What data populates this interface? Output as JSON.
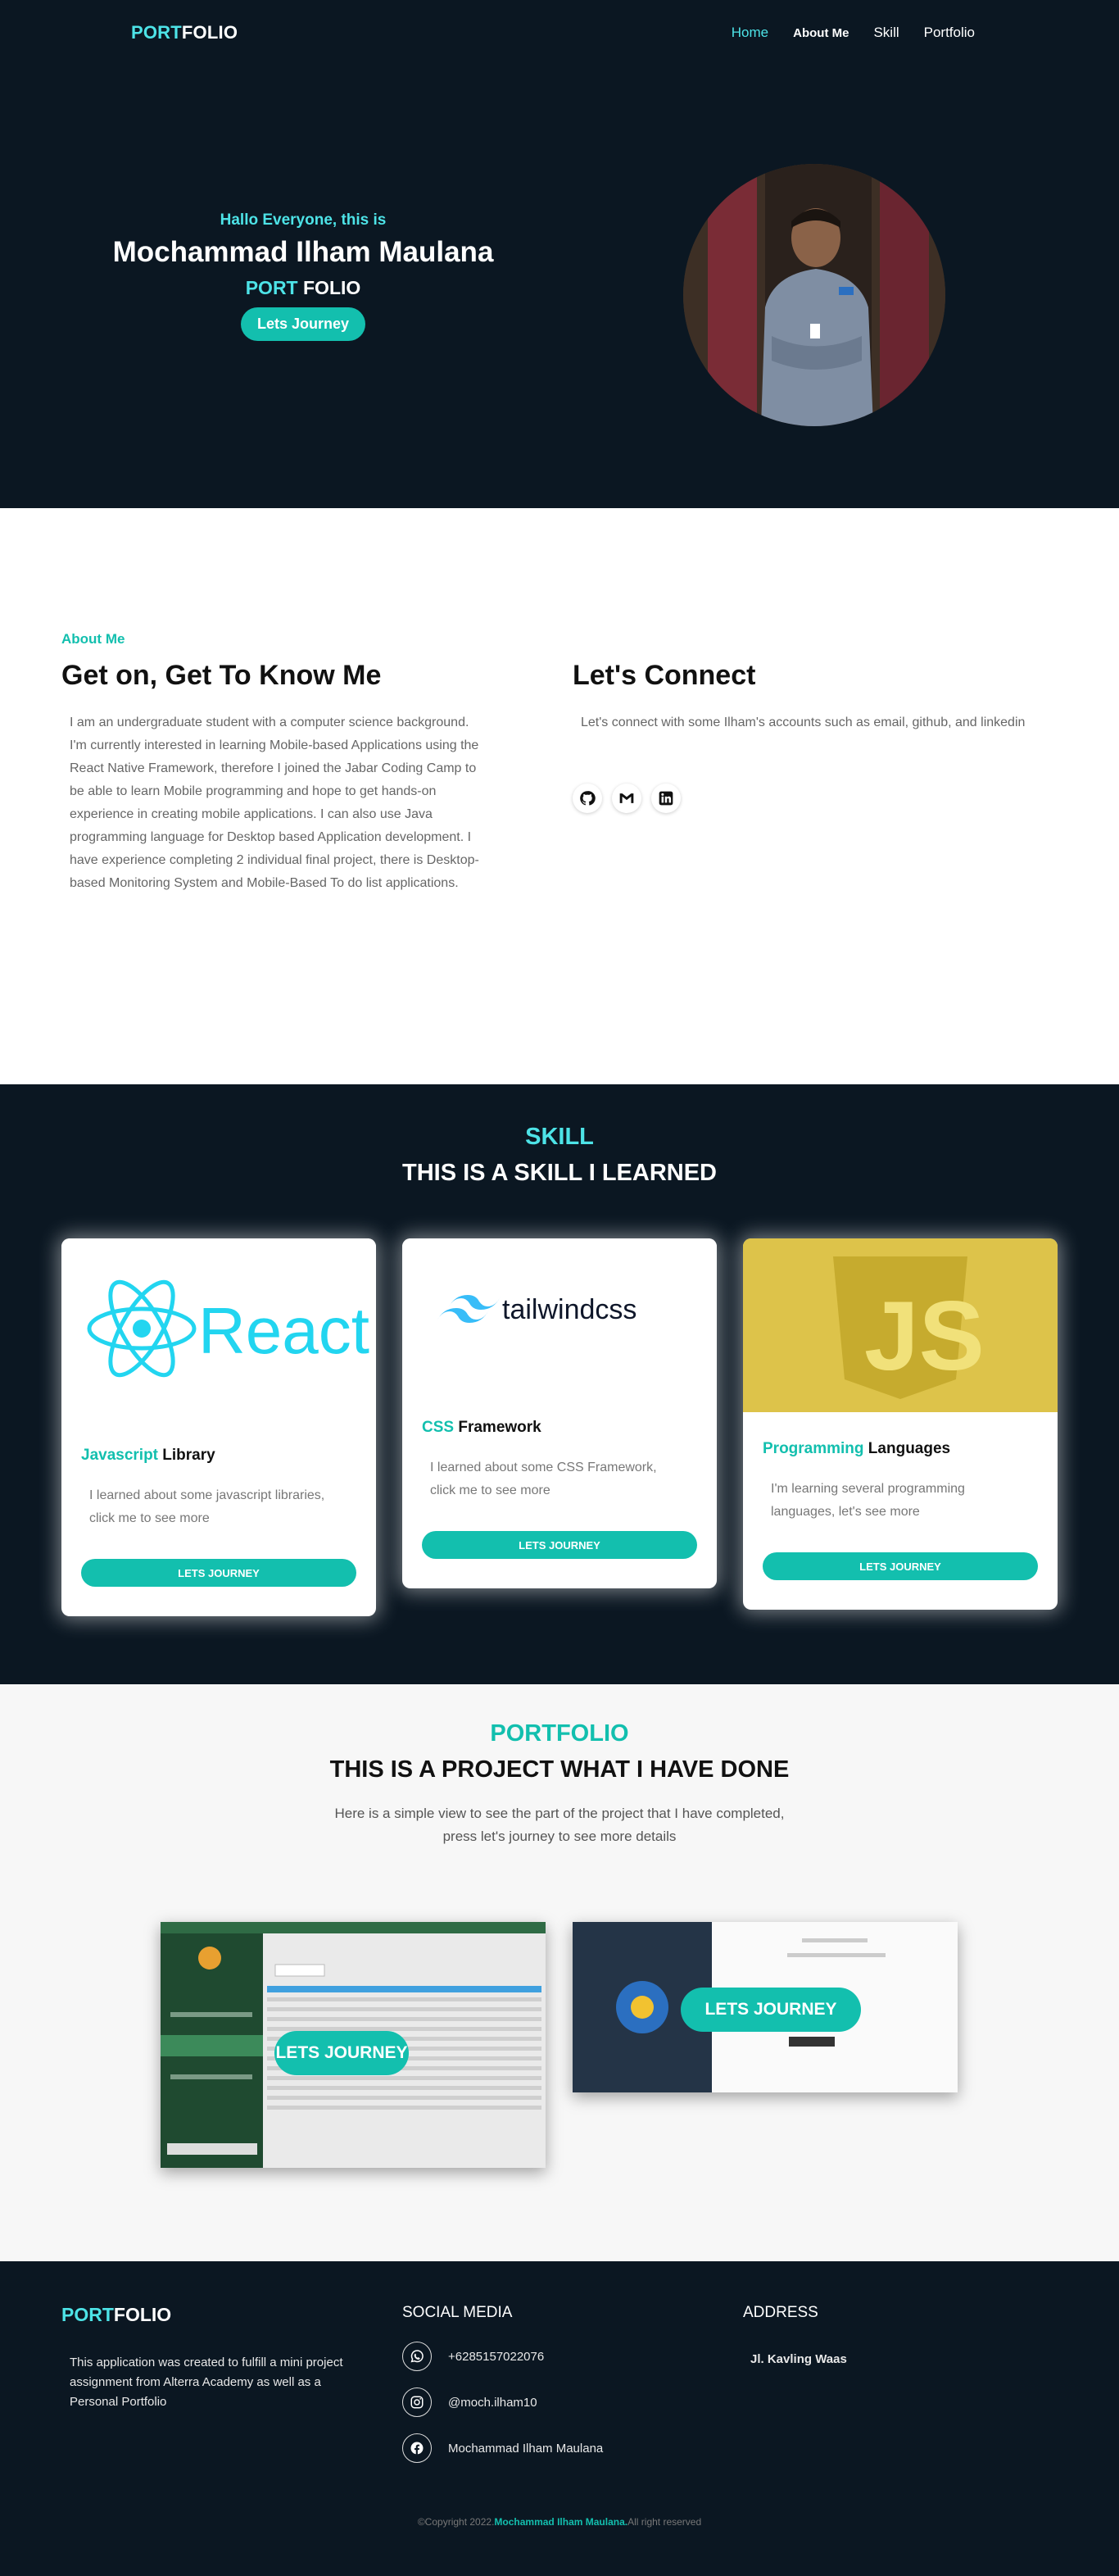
{
  "nav": {
    "logo_part1": "PORT",
    "logo_part2": "FOLIO",
    "links": [
      "Home",
      "About Me",
      "Skill",
      "Portfolio"
    ]
  },
  "hero": {
    "greeting": "Hallo Everyone, this is",
    "name": "Mochammad Ilham Maulana",
    "sub_part1": "PORT",
    "sub_part2": "FOLIO",
    "button": "Lets Journey"
  },
  "about": {
    "tag": "About Me",
    "title": "Get on, Get To Know Me",
    "text": "I am an undergraduate student with a computer science background. I'm currently interested in learning Mobile-based Applications using the React Native Framework, therefore I joined the Jabar Coding Camp to be able to learn Mobile programming and hope to get hands-on experience in creating mobile applications. I can also use Java programming language for Desktop based Application development. I have experience completing 2 individual final project, there is Desktop-based Monitoring System and Mobile-Based To do list applications.",
    "connect_title": "Let's Connect",
    "connect_text": "Let's connect with some Ilham's accounts such as email, github, and linkedin",
    "icons": [
      "github-icon",
      "gmail-icon",
      "linkedin-icon"
    ]
  },
  "skill": {
    "tag": "SKILL",
    "title": "THIS IS A SKILL I LEARNED",
    "cards": [
      {
        "logo_text": "React",
        "title_accent": "Javascript",
        "title_rest": " Library",
        "desc": "I learned about some javascript libraries, click me to see more",
        "button": "LETS JOURNEY"
      },
      {
        "logo_text": "tailwindcss",
        "title_accent": "CSS",
        "title_rest": " Framework",
        "desc": "I learned about some CSS Framework, click me to see more",
        "button": "LETS JOURNEY"
      },
      {
        "logo_text": "JS",
        "title_accent": "Programming",
        "title_rest": " Languages",
        "desc": "I'm learning several programming languages, let's see more",
        "button": "LETS JOURNEY"
      }
    ]
  },
  "portfolio": {
    "tag": "PORTFOLIO",
    "title": "THIS IS A PROJECT WHAT I HAVE DONE",
    "desc": "Here is a simple view to see the part of the project that I have completed, press let's journey to see more details",
    "buttons": [
      "LETS JOURNEY",
      "LETS JOURNEY"
    ]
  },
  "footer": {
    "logo_part1": "PORT",
    "logo_part2": "FOLIO",
    "about": "This application was created to fulfill a mini project assignment from Alterra Academy as well as a Personal Portfolio",
    "social_head": "SOCIAL MEDIA",
    "phone": "+6285157022076",
    "instagram": "@moch.ilham10",
    "facebook": "Mochammad Ilham Maulana",
    "address_head": "ADDRESS",
    "address": "Jl. Kavling Waas",
    "copy_pre": "©Copyright 2022.",
    "copy_name": "Mochammad Ilham Maulana.",
    "copy_post": "All right reserved"
  },
  "colors": {
    "dark_bg": "#0b1722",
    "accent_cyan": "#4de3e7",
    "teal": "#13bfae"
  }
}
